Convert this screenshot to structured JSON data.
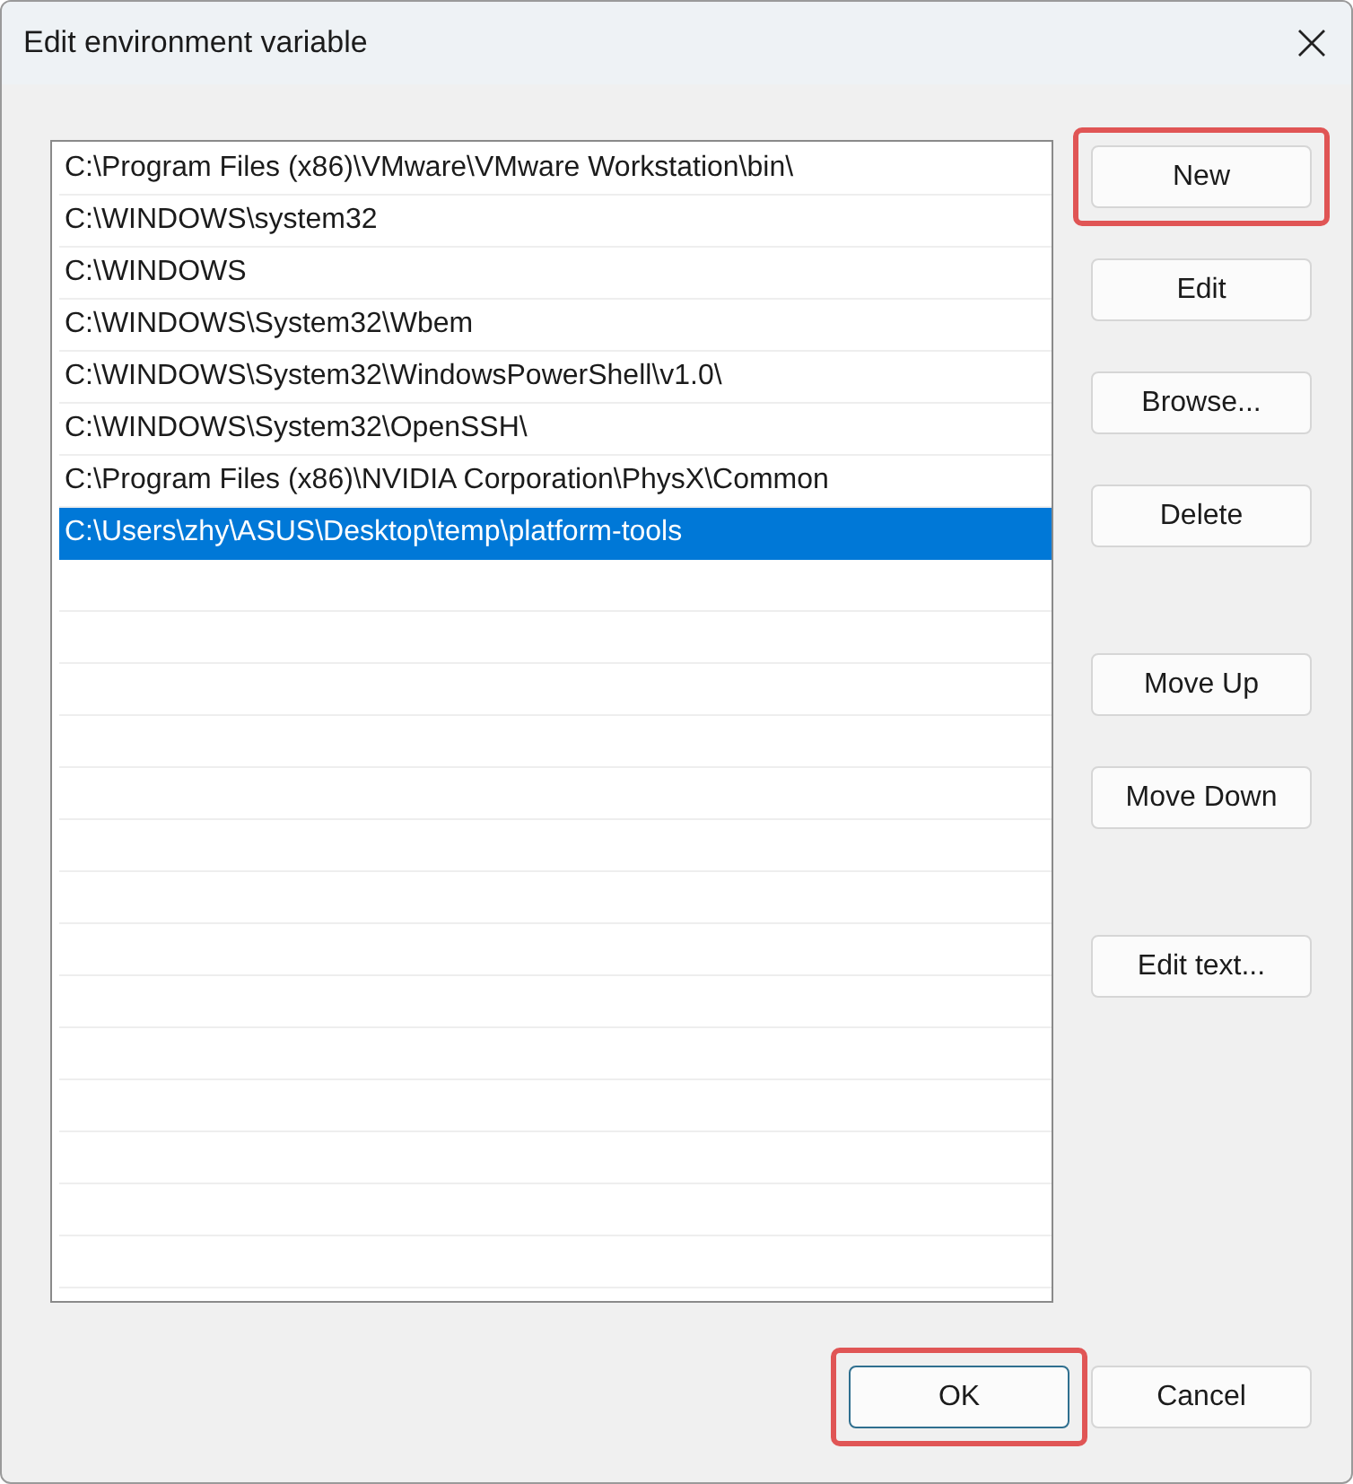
{
  "window": {
    "title": "Edit environment variable"
  },
  "list": {
    "rows": [
      {
        "text": "C:\\Program Files (x86)\\VMware\\VMware Workstation\\bin\\",
        "selected": false
      },
      {
        "text": "C:\\WINDOWS\\system32",
        "selected": false
      },
      {
        "text": "C:\\WINDOWS",
        "selected": false
      },
      {
        "text": "C:\\WINDOWS\\System32\\Wbem",
        "selected": false
      },
      {
        "text": "C:\\WINDOWS\\System32\\WindowsPowerShell\\v1.0\\",
        "selected": false
      },
      {
        "text": "C:\\WINDOWS\\System32\\OpenSSH\\",
        "selected": false
      },
      {
        "text": "C:\\Program Files (x86)\\NVIDIA Corporation\\PhysX\\Common",
        "selected": false
      },
      {
        "text": "C:\\Users\\zhy\\ASUS\\Desktop\\temp\\platform-tools",
        "selected": true
      }
    ]
  },
  "side_button_groups": [
    [
      {
        "label": "New",
        "highlighted": true
      },
      {
        "label": "Edit",
        "highlighted": false
      },
      {
        "label": "Browse...",
        "highlighted": false
      },
      {
        "label": "Delete",
        "highlighted": false
      }
    ],
    [
      {
        "label": "Move Up",
        "highlighted": false
      },
      {
        "label": "Move Down",
        "highlighted": false
      }
    ],
    [
      {
        "label": "Edit text...",
        "highlighted": false
      }
    ]
  ],
  "footer_buttons": [
    {
      "label": "OK",
      "highlighted": true,
      "default": true
    },
    {
      "label": "Cancel",
      "highlighted": false,
      "default": false
    }
  ]
}
